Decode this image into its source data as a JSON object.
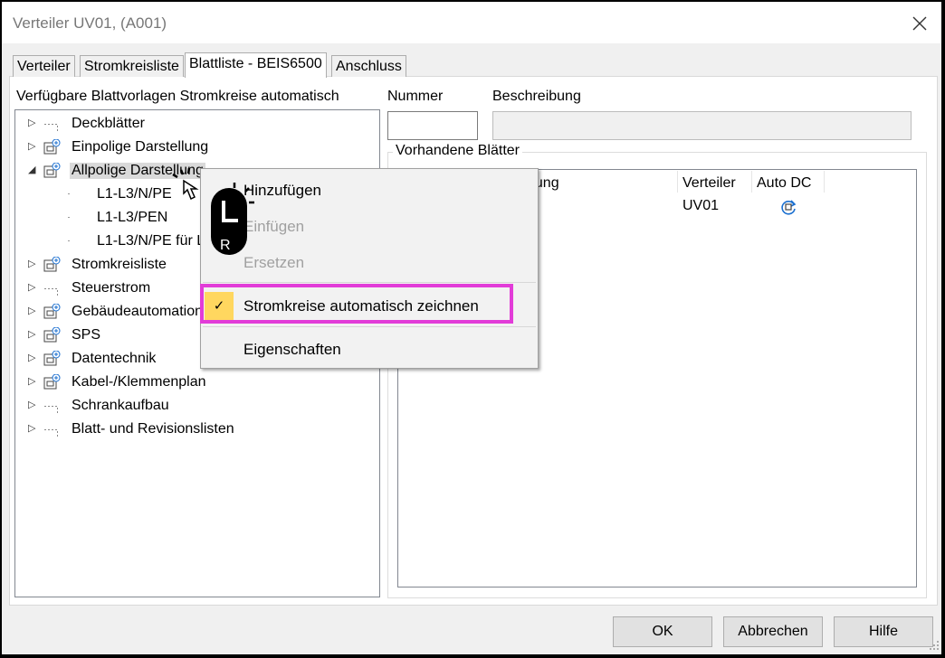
{
  "window": {
    "title": "Verteiler UV01,  (A001)"
  },
  "tabs": [
    {
      "label": "Verteiler"
    },
    {
      "label": "Stromkreisliste"
    },
    {
      "label": "Blattliste - BEIS6500"
    },
    {
      "label": "Anschluss"
    }
  ],
  "left": {
    "heading": "Verfügbare Blattvorlagen Stromkreise automatisch",
    "tree": [
      {
        "label": "Deckblätter",
        "expander": "▷",
        "icon": "folder-dotted-icon"
      },
      {
        "label": "Einpolige Darstellung",
        "expander": "▷",
        "icon": "template-plus-icon"
      },
      {
        "label": "Allpolige Darstellung",
        "expander": "◢",
        "icon": "template-plus-icon"
      },
      {
        "label": "L1-L3/N/PE"
      },
      {
        "label": "L1-L3/PEN"
      },
      {
        "label": "L1-L3/N/PE für L"
      },
      {
        "label": "Stromkreisliste",
        "expander": "▷",
        "icon": "template-plus-icon"
      },
      {
        "label": "Steuerstrom",
        "expander": "▷",
        "icon": "folder-dotted-icon"
      },
      {
        "label": "Gebäudeautomation",
        "expander": "▷",
        "icon": "template-plus-icon"
      },
      {
        "label": "SPS",
        "expander": "▷",
        "icon": "template-plus-icon"
      },
      {
        "label": "Datentechnik",
        "expander": "▷",
        "icon": "template-plus-icon"
      },
      {
        "label": "Kabel-/Klemmenplan",
        "expander": "▷",
        "icon": "template-plus-icon"
      },
      {
        "label": "Schrankaufbau",
        "expander": "▷",
        "icon": "folder-dotted-icon"
      },
      {
        "label": "Blatt- und Revisionslisten",
        "expander": "▷",
        "icon": "folder-dotted-icon"
      }
    ]
  },
  "right": {
    "nummer_label": "Nummer",
    "nummer_value": "",
    "beschreibung_label": "Beschreibung",
    "beschreibung_value": "",
    "group_title": "Vorhandene Blätter",
    "columns": [
      "bung",
      "Verteiler",
      "Auto DC"
    ],
    "rows": [
      {
        "verteiler": "UV01",
        "auto_dc_icon": "refresh-icon"
      }
    ]
  },
  "context_menu": {
    "items": [
      {
        "label": "Hinzufügen",
        "enabled": true
      },
      {
        "label": "Einfügen",
        "enabled": false
      },
      {
        "label": "Ersetzen",
        "enabled": false
      },
      {
        "label": "Stromkreise automatisch zeichnen",
        "checked": true,
        "check_glyph": "✓"
      },
      {
        "label": "Eigenschaften",
        "enabled": true
      }
    ]
  },
  "overlay": {
    "mouse_button_letter": "R"
  },
  "buttons": {
    "ok": "OK",
    "cancel": "Abbrechen",
    "help": "Hilfe"
  },
  "colors": {
    "highlight": "#e23cd8",
    "check_bg": "#ffd75f"
  }
}
